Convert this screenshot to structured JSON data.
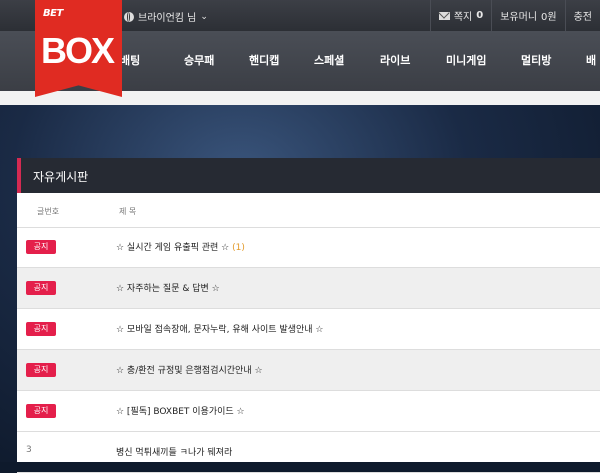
{
  "top": {
    "user": "브라이언킴 님",
    "messages_label": "쪽지",
    "messages_count": "0",
    "balance_label": "보유머니",
    "balance_value": "0원",
    "charge": "충전"
  },
  "logo": {
    "small": "BET",
    "big": "BOX"
  },
  "nav": [
    "크로스배팅",
    "승무패",
    "핸디캡",
    "스페셜",
    "라이브",
    "미니게임",
    "멀티방",
    "배팅"
  ],
  "nav_visible": [
    "배팅",
    "승무패",
    "핸디캡",
    "스페셜",
    "라이브",
    "미니게임",
    "멀티방",
    "배"
  ],
  "board": {
    "title": "자유게시판",
    "col_num": "글번호",
    "col_subject": "제 목",
    "rows": [
      {
        "badge": "공지",
        "subject": "☆ 실시간 게임 유출픽 관련 ☆",
        "count": "(1)"
      },
      {
        "badge": "공지",
        "subject": "☆ 자주하는 질문 & 답변 ☆",
        "count": ""
      },
      {
        "badge": "공지",
        "subject": "☆ 모바일 접속장애, 문자누락, 유해 사이트 발생안내 ☆",
        "count": ""
      },
      {
        "badge": "공지",
        "subject": "☆ 충/환전 규정및 은행점검시간안내 ☆",
        "count": ""
      },
      {
        "badge": "공지",
        "subject": "☆ [필독] BOXBET 이용가이드 ☆",
        "count": ""
      },
      {
        "num": "3",
        "subject": "병신 먹튀새끼들 ㅋ나가 뒈져라"
      }
    ]
  }
}
